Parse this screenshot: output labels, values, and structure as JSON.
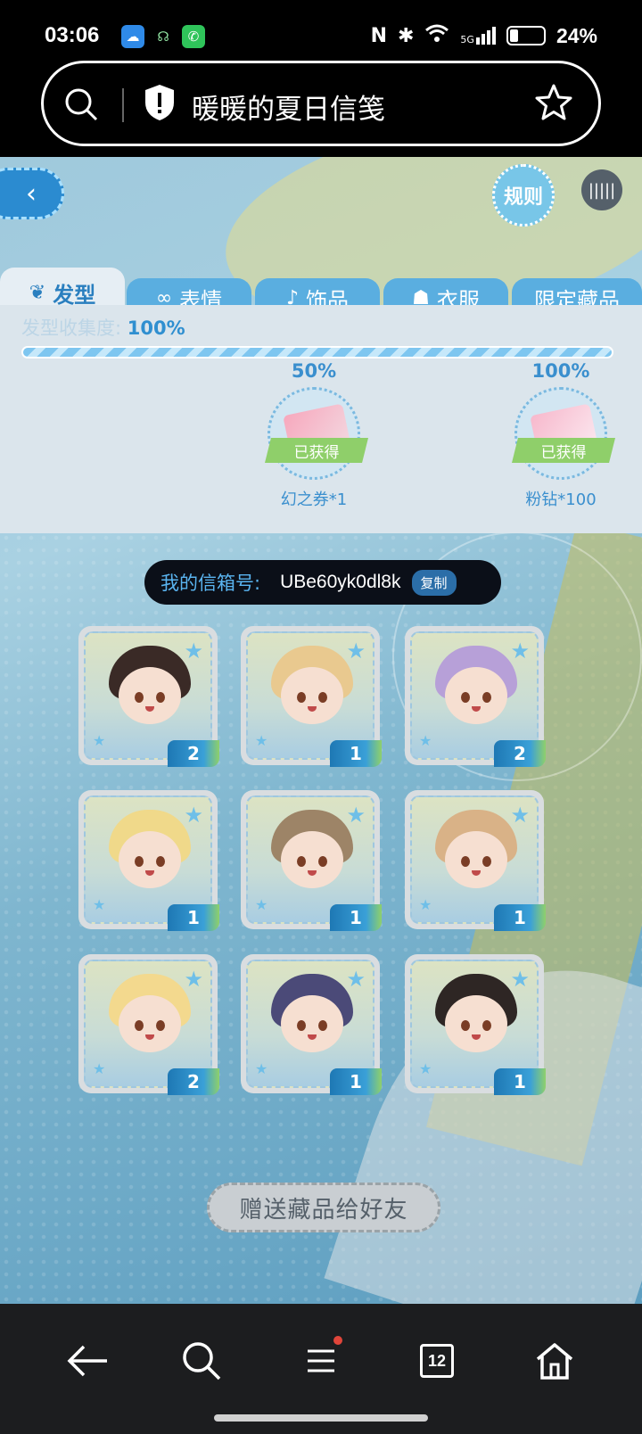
{
  "status_bar": {
    "time": "03:06",
    "signal_label": "5G",
    "battery_percent": "24%",
    "battery_level": 0.24
  },
  "url_bar": {
    "title": "暖暖的夏日信笺"
  },
  "page": {
    "rules_label": "规则",
    "tabs": [
      {
        "label": "发型",
        "icon": "hair-icon",
        "active": true
      },
      {
        "label": "表情",
        "icon": "mask-icon",
        "active": false
      },
      {
        "label": "饰品",
        "icon": "accessory-icon",
        "active": false
      },
      {
        "label": "衣服",
        "icon": "clothes-icon",
        "active": false
      },
      {
        "label": "限定藏品",
        "icon": "",
        "active": false
      }
    ],
    "collection": {
      "label": "发型收集度:",
      "value": "100%",
      "progress": 1.0
    },
    "rewards": [
      {
        "threshold": "50%",
        "status": "已获得",
        "name": "幻之券*1"
      },
      {
        "threshold": "100%",
        "status": "已获得",
        "name": "粉钻*100"
      }
    ],
    "mailbox": {
      "label": "我的信箱号:",
      "code": "UBe60yk0dl8k",
      "copy_label": "复制"
    },
    "items": [
      {
        "count": "2",
        "hair_color": "#3a2a26"
      },
      {
        "count": "1",
        "hair_color": "#e9c98f"
      },
      {
        "count": "2",
        "hair_color": "#b7a0d8"
      },
      {
        "count": "1",
        "hair_color": "#f0d98a"
      },
      {
        "count": "1",
        "hair_color": "#9d8467"
      },
      {
        "count": "1",
        "hair_color": "#d9b287"
      },
      {
        "count": "2",
        "hair_color": "#f3d98e"
      },
      {
        "count": "1",
        "hair_color": "#4b4a78"
      },
      {
        "count": "1",
        "hair_color": "#2e2624"
      }
    ],
    "gift_button": "赠送藏品给好友"
  },
  "bottom_nav": {
    "tab_count": "12"
  }
}
